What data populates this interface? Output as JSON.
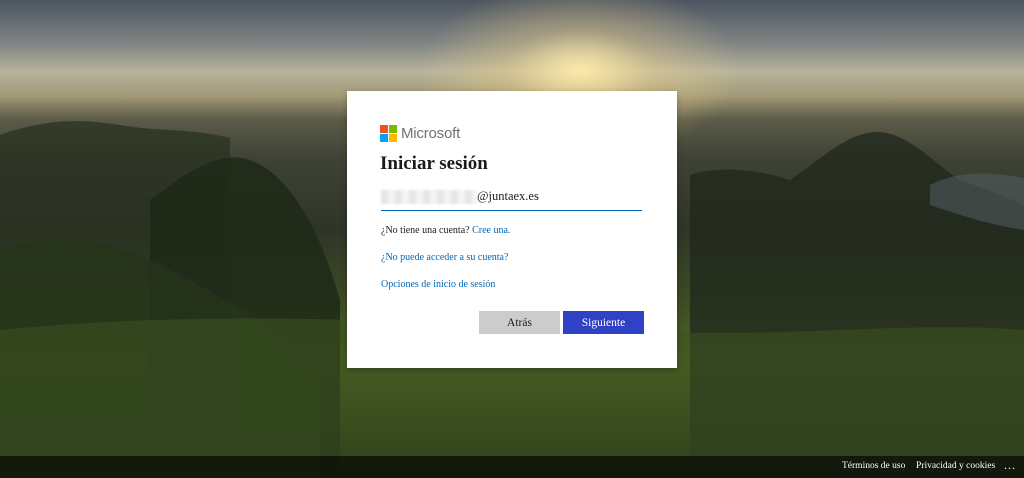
{
  "dialog": {
    "brand": "Microsoft",
    "title": "Iniciar sesión",
    "account_domain": "@juntaex.es",
    "no_account_text": "¿No tiene una cuenta?",
    "create_account_link": "Cree una.",
    "cant_access_link": "¿No puede acceder a su cuenta?",
    "signin_options_link": "Opciones de inicio de sesión",
    "back_button": "Atrás",
    "next_button": "Siguiente"
  },
  "footer": {
    "terms": "Términos de uso",
    "privacy": "Privacidad y cookies",
    "more": "..."
  },
  "colors": {
    "logo_red": "#f25022",
    "logo_green": "#7fba00",
    "logo_blue": "#00a4ef",
    "logo_yellow": "#ffb900",
    "primary_button": "#2f42c6",
    "secondary_button": "#cccccc",
    "link": "#0067b8"
  }
}
